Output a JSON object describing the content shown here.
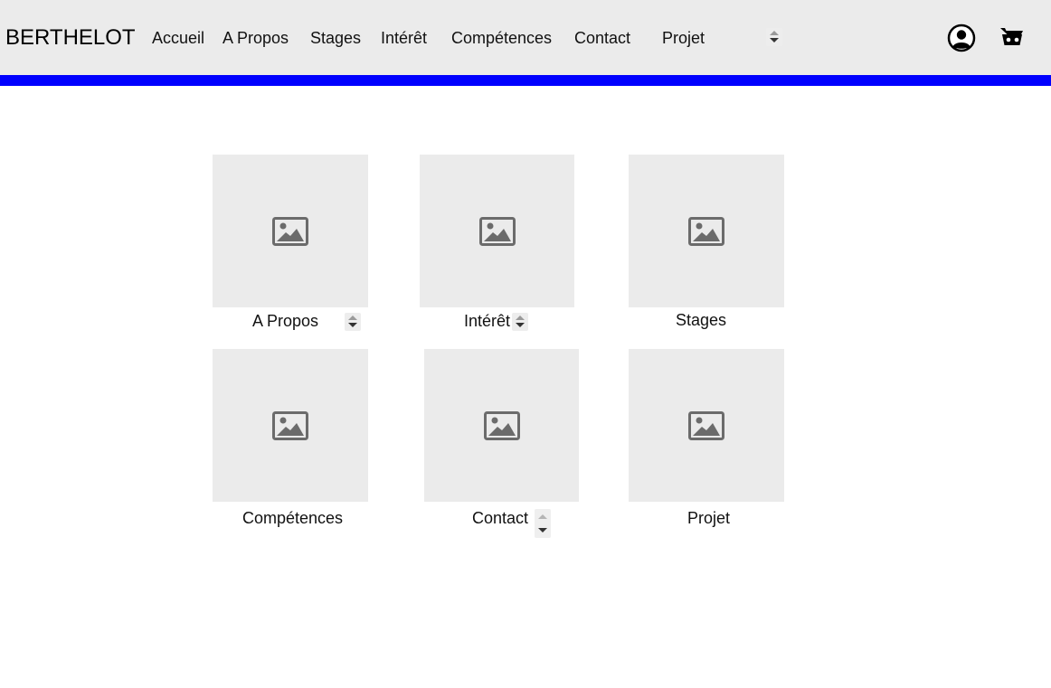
{
  "colors": {
    "header_bg": "#ebebeb",
    "accent": "#0000ff",
    "tile_bg": "#ebebeb",
    "icon": "#6b6b6b"
  },
  "header": {
    "brand": "BERTHELOT",
    "nav": [
      {
        "label": "Accueil"
      },
      {
        "label": "A Propos"
      },
      {
        "label": "Stages"
      },
      {
        "label": "Intérêt"
      },
      {
        "label": "Compétences"
      },
      {
        "label": "Contact"
      },
      {
        "label": "Projet"
      }
    ],
    "icons": {
      "account": "user-circle-icon",
      "cart": "cart-icon"
    }
  },
  "tiles": [
    {
      "label": "A Propos",
      "image_icon": "image-placeholder-icon"
    },
    {
      "label": "Intérêt",
      "image_icon": "image-placeholder-icon"
    },
    {
      "label": "Stages",
      "image_icon": "image-placeholder-icon"
    },
    {
      "label": "Compétences",
      "image_icon": "image-placeholder-icon"
    },
    {
      "label": "Contact",
      "image_icon": "image-placeholder-icon"
    },
    {
      "label": "Projet",
      "image_icon": "image-placeholder-icon"
    }
  ]
}
